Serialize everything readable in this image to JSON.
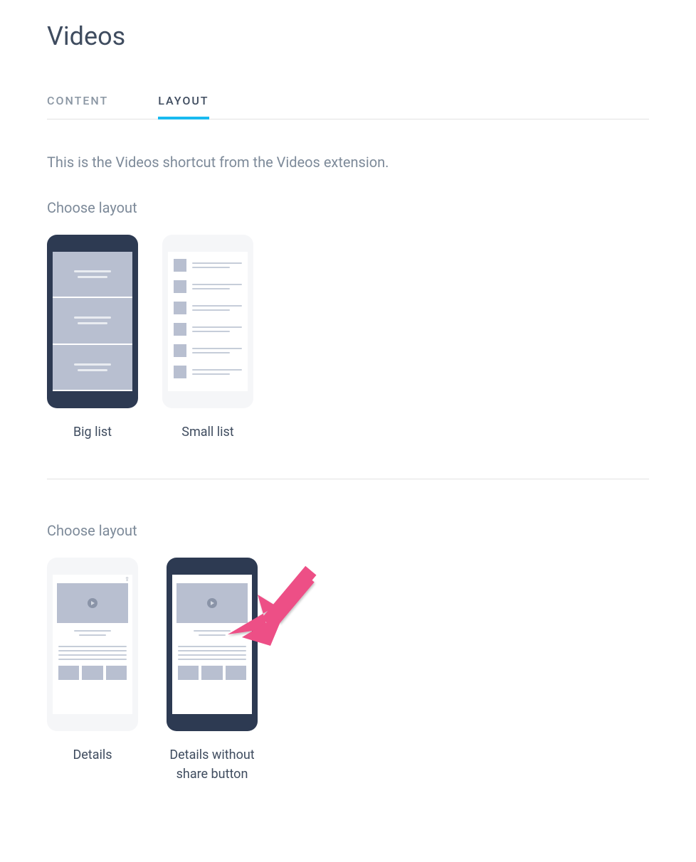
{
  "page": {
    "title": "Videos"
  },
  "tabs": [
    {
      "label": "CONTENT",
      "active": false
    },
    {
      "label": "LAYOUT",
      "active": true
    }
  ],
  "description": "This is the Videos shortcut from the Videos extension.",
  "section1": {
    "label": "Choose layout",
    "options": [
      {
        "caption": "Big list",
        "selected": true
      },
      {
        "caption": "Small list",
        "selected": false
      }
    ]
  },
  "section2": {
    "label": "Choose layout",
    "options": [
      {
        "caption": "Details",
        "selected": false
      },
      {
        "caption": "Details without share button",
        "selected": true
      }
    ]
  }
}
